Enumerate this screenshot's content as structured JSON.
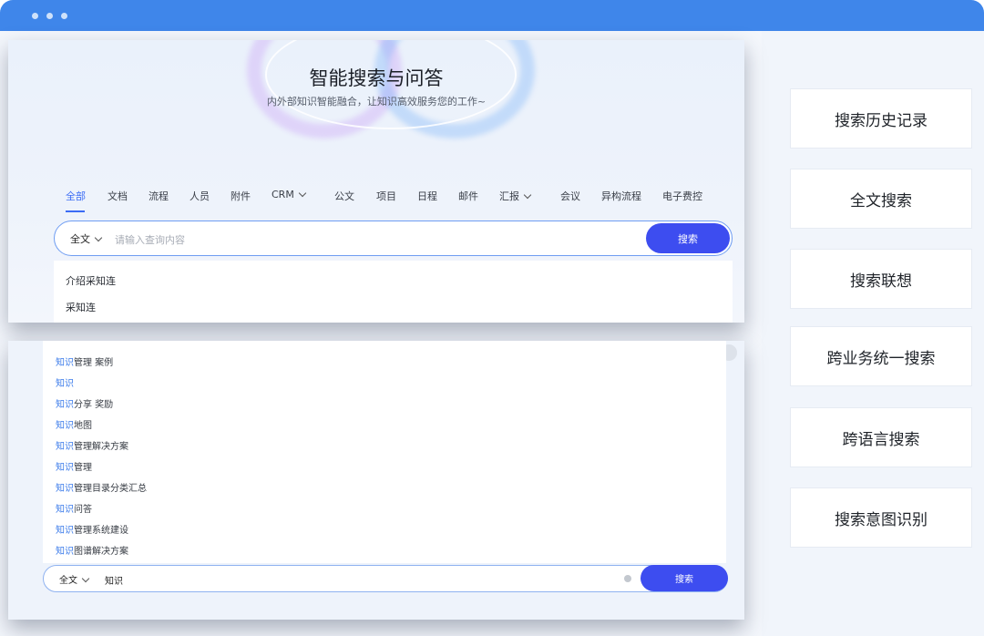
{
  "window": {
    "controls": [
      "dot",
      "dot",
      "dot"
    ]
  },
  "hero": {
    "title": "智能搜索与问答",
    "subtitle": "内外部知识智能融合，让知识高效服务您的工作~"
  },
  "tabs": [
    {
      "label": "全部",
      "active": true
    },
    {
      "label": "文档"
    },
    {
      "label": "流程"
    },
    {
      "label": "人员"
    },
    {
      "label": "附件"
    },
    {
      "label": "CRM",
      "dropdown": true
    },
    {
      "label": "公文"
    },
    {
      "label": "项目"
    },
    {
      "label": "日程"
    },
    {
      "label": "邮件"
    },
    {
      "label": "汇报",
      "dropdown": true
    },
    {
      "label": "会议"
    },
    {
      "label": "异构流程"
    },
    {
      "label": "电子费控"
    }
  ],
  "search_top": {
    "scope": "全文",
    "placeholder": "请输入查询内容",
    "button": "搜索",
    "suggestions": [
      "介绍采知连",
      "采知连"
    ]
  },
  "search_bottom": {
    "scope": "全文",
    "query": "知识",
    "button": "搜索",
    "highlight": "知识",
    "suggestions": [
      {
        "hl": "知识",
        "rest": "管理 案例"
      },
      {
        "hl": "知识",
        "rest": ""
      },
      {
        "hl": "知识",
        "rest": "分享 奖励"
      },
      {
        "hl": "知识",
        "rest": "地图"
      },
      {
        "hl": "知识",
        "rest": "管理解决方案"
      },
      {
        "hl": "知识",
        "rest": "管理"
      },
      {
        "hl": "知识",
        "rest": "管理目录分类汇总"
      },
      {
        "hl": "知识",
        "rest": "问答"
      },
      {
        "hl": "知识",
        "rest": "管理系统建设"
      },
      {
        "hl": "知识",
        "rest": "图谱解决方案"
      }
    ]
  },
  "features": [
    "搜索历史记录",
    "全文搜索",
    "搜索联想",
    "跨业务统一搜索",
    "跨语言搜索",
    "搜索意图识别"
  ],
  "colors": {
    "titlebar": "#3f86ea",
    "accent": "#3b6cf5",
    "button": "#3d4df0",
    "highlight": "#3b7bea"
  }
}
